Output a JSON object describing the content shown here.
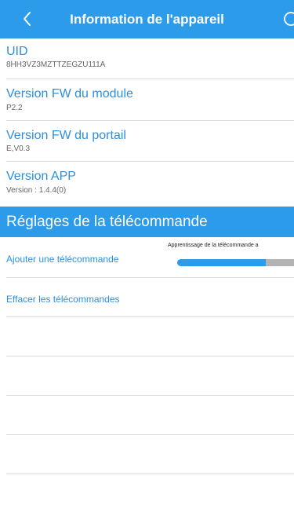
{
  "header": {
    "title": "Information de l'appareil",
    "back_icon": "chevron-left-icon",
    "refresh_icon": "refresh-icon"
  },
  "info": [
    {
      "label": "UID",
      "value": "8HH3VZ3MZTTZEGZU111A"
    },
    {
      "label": "Version FW du module",
      "value": "P2.2"
    },
    {
      "label": "Version FW du portail",
      "value": "E,V0.3"
    },
    {
      "label": "Version APP",
      "value": "Version : 1.4.4(0)"
    }
  ],
  "remote_section": {
    "title": "Réglages de la télécommande",
    "add_label": "Ajouter une télécommande",
    "clear_label": "Effacer les télécommandes",
    "progress_caption": "Apprentissage de la télécommande a",
    "progress_fraction": 0.76
  },
  "colors": {
    "accent": "#2c9bea",
    "label_blue": "#2d8fe0",
    "value_gray": "#666666",
    "divider": "#dddddd",
    "track": "#b3b3b3"
  }
}
